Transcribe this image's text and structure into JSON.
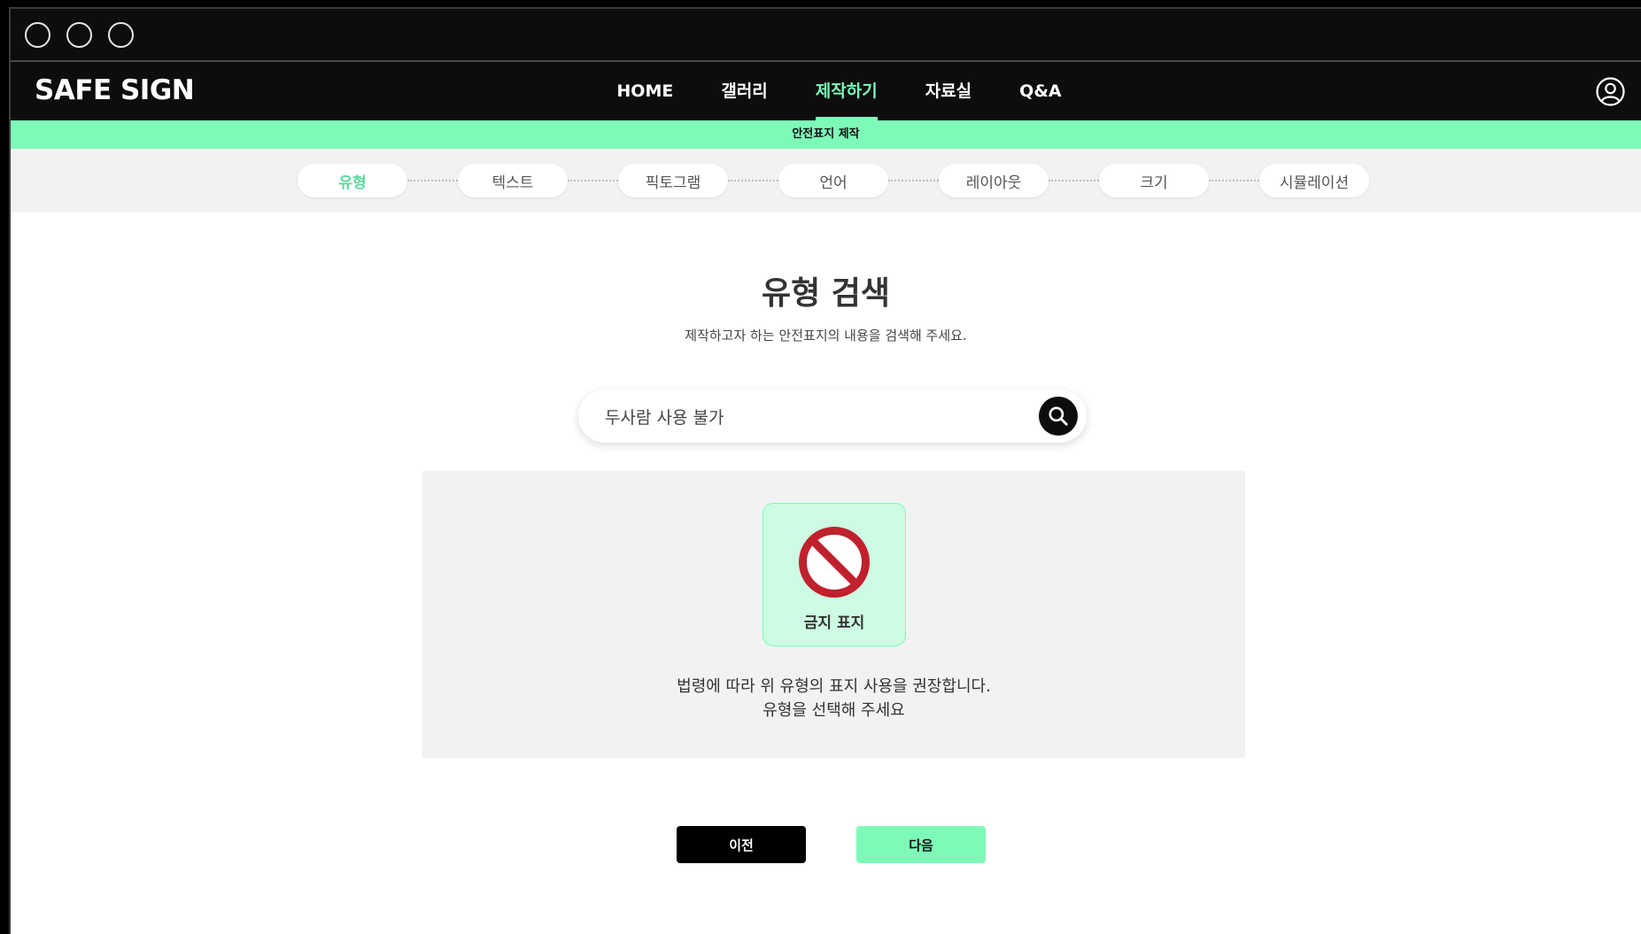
{
  "window": {
    "controls": [
      "window-circle-1",
      "window-circle-2",
      "window-circle-3"
    ]
  },
  "header": {
    "logo": "SAFE SIGN",
    "nav": [
      {
        "label": "HOME",
        "active": false
      },
      {
        "label": "갤러리",
        "active": false
      },
      {
        "label": "제작하기",
        "active": true
      },
      {
        "label": "자료실",
        "active": false
      },
      {
        "label": "Q&A",
        "active": false
      }
    ],
    "user_icon": "user-circle-icon"
  },
  "subbanner": {
    "label": "안전표지 제작"
  },
  "steps": [
    {
      "label": "유형",
      "active": true
    },
    {
      "label": "텍스트",
      "active": false
    },
    {
      "label": "픽토그램",
      "active": false
    },
    {
      "label": "언어",
      "active": false
    },
    {
      "label": "레이아웃",
      "active": false
    },
    {
      "label": "크기",
      "active": false
    },
    {
      "label": "시뮬레이션",
      "active": false
    }
  ],
  "main": {
    "title": "유형 검색",
    "subtitle": "제작하고자 하는 안전표지의 내용을 검색해 주세요.",
    "search": {
      "value": "두사람 사용 불가",
      "icon": "search-icon"
    },
    "result": {
      "card_label": "금지 표지",
      "card_icon": "prohibition-icon",
      "message_line1": "법령에 따라 위 유형의 표지 사용을 권장합니다.",
      "message_line2": "유형을 선택해 주세요"
    },
    "buttons": {
      "prev": "이전",
      "next": "다음"
    }
  },
  "colors": {
    "accent": "#7dfab8",
    "dark": "#0d0d0d",
    "prohibit_red": "#c0212c",
    "card_bg": "#cdfbe3",
    "panel_bg": "#f2f2f3"
  }
}
